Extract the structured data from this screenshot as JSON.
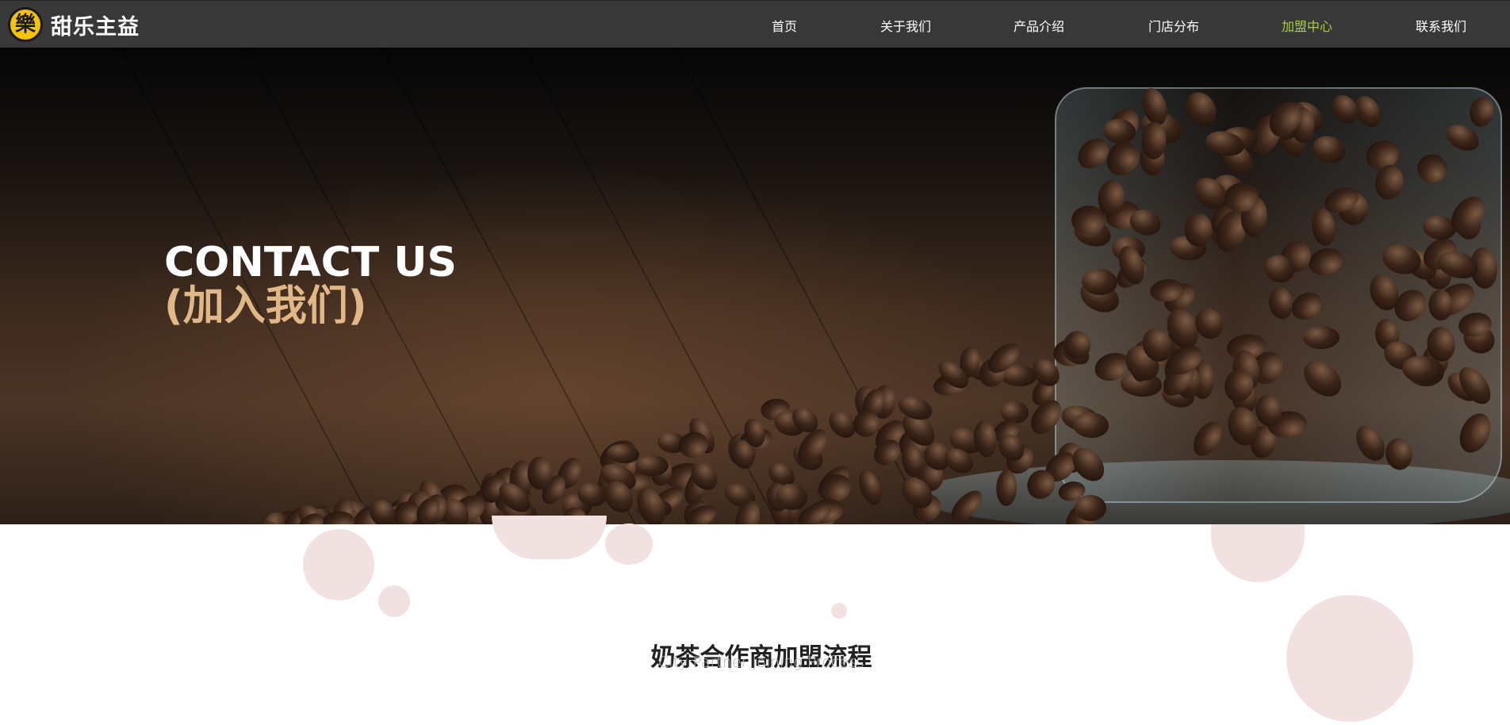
{
  "brand": {
    "logo_glyph": "樂",
    "name": "甜乐主益",
    "accent_color": "#f2c500"
  },
  "nav": {
    "items": [
      {
        "label": "首页",
        "active": false
      },
      {
        "label": "关于我们",
        "active": false
      },
      {
        "label": "产品介绍",
        "active": false
      },
      {
        "label": "门店分布",
        "active": false
      },
      {
        "label": "加盟中心",
        "active": true
      },
      {
        "label": "联系我们",
        "active": false
      }
    ],
    "active_color": "#a6d13d"
  },
  "hero": {
    "title": "CONTACT US",
    "subtitle": "(加入我们)",
    "subtitle_color": "#e0b887",
    "image": "coffee-beans-in-glass"
  },
  "section": {
    "title": "奶茶合作商加盟流程",
    "subtitle": "City Partner Joining Process"
  }
}
